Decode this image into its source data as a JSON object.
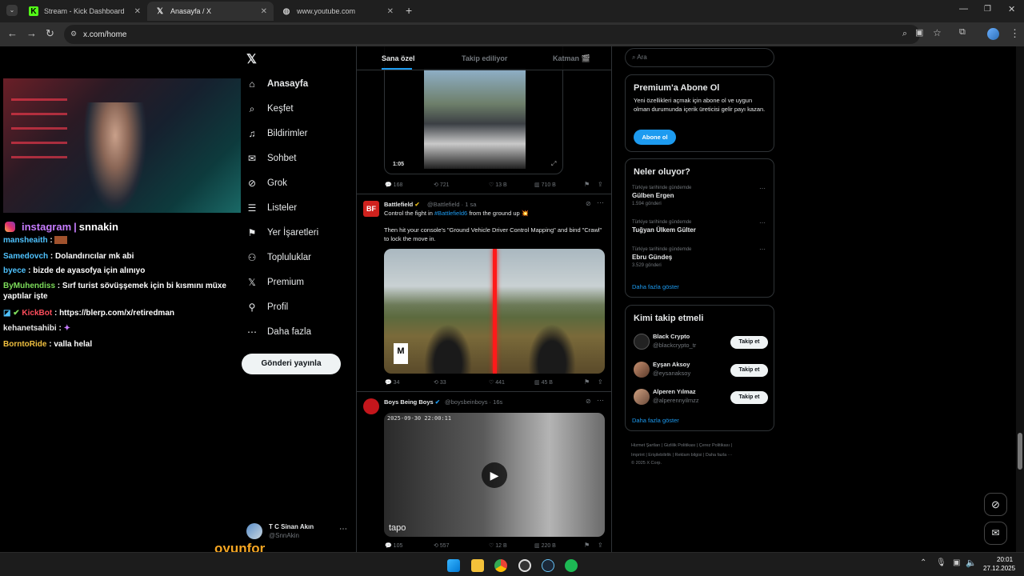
{
  "browser": {
    "tabs": [
      {
        "title": "Stream - Kick Dashboard",
        "icon": "kick-icon"
      },
      {
        "title": "Anasayfa / X",
        "icon": "x-logo-icon"
      },
      {
        "title": "www.youtube.com",
        "icon": "globe-icon"
      }
    ],
    "url": "x.com/home"
  },
  "stream": {
    "banner_left": "instagram",
    "banner_sep": "|",
    "banner_right": "snnakin",
    "chat": [
      {
        "user": "mansheaith",
        "msg": "",
        "color": "#4fc3ff"
      },
      {
        "user": "Samedovch",
        "msg": "Dolandırıcılar mk abi",
        "color": "#4fc3ff"
      },
      {
        "user": "byece",
        "msg": "bizde de ayasofya için alınıyo",
        "color": "#4fc3ff"
      },
      {
        "user": "ByMuhendiss",
        "msg": "Sırf turist sövüşşemek için bi kısmını müxe yaptılar işte",
        "color": "#7ddc5a"
      },
      {
        "user": "KickBot",
        "msg": "https://blerp.com/x/retiredman",
        "color": "#ff4d5c"
      },
      {
        "user": "kehanetsahibi",
        "msg": "",
        "color": "#e8e8e8"
      },
      {
        "user": "BorntoRide",
        "msg": "valla helal",
        "color": "#f0c040"
      }
    ],
    "watermark": "oyunfor"
  },
  "xnav": {
    "items": [
      {
        "label": "Anasayfa",
        "icon": "home-icon"
      },
      {
        "label": "Keşfet",
        "icon": "search-icon"
      },
      {
        "label": "Bildirimler",
        "icon": "bell-icon"
      },
      {
        "label": "Sohbet",
        "icon": "mail-icon"
      },
      {
        "label": "Grok",
        "icon": "grok-icon"
      },
      {
        "label": "Listeler",
        "icon": "list-icon"
      },
      {
        "label": "Yer İşaretleri",
        "icon": "bookmark-icon"
      },
      {
        "label": "Topluluklar",
        "icon": "people-icon"
      },
      {
        "label": "Premium",
        "icon": "x-logo-icon"
      },
      {
        "label": "Profil",
        "icon": "person-icon"
      },
      {
        "label": "Daha fazla",
        "icon": "more-icon"
      }
    ],
    "post_button": "Gönderi yayınla",
    "profile": {
      "name": "T C Sinan Akın",
      "handle": "@SnnAkin"
    }
  },
  "feed": {
    "tabs": [
      "Sana özel",
      "Takip ediliyor",
      "Katman 🎬"
    ],
    "post1": {
      "duration": "1:05",
      "replies": "168",
      "reposts": "721",
      "likes": "13 B",
      "views": "710 B"
    },
    "post2": {
      "name": "Battlefield",
      "handle": "@Battlefield · 1 sa",
      "text1": "Control the fight in ",
      "hashtag": "#Battlefield6",
      "text1b": " from the ground up 💥",
      "text2": "Then hit your console's \"Ground Vehicle Driver Control Mapping\" and bind \"Crawl\" to lock the move in.",
      "replies": "34",
      "reposts": "33",
      "likes": "441",
      "views": "45 B"
    },
    "post3": {
      "name": "Boys Being Boys",
      "handle": "@boysbeinboys · 16s",
      "timestamp": "2025-09-30 22:00:11",
      "logo": "tapo",
      "replies": "105",
      "reposts": "557",
      "likes": "12 B",
      "views": "220 B"
    }
  },
  "right": {
    "search_placeholder": "Ara",
    "premium": {
      "title": "Premium'a Abone Ol",
      "text": "Yeni özellikleri açmak için abone ol ve uygun olman durumunda içerik üreticisi gelir payı kazan.",
      "button": "Abone ol"
    },
    "trends_title": "Neler oluyor?",
    "trends": [
      {
        "context": "Türkiye tarihinde gündemde",
        "name": "Gülben Ergen",
        "count": "1.594 gönderi"
      },
      {
        "context": "Türkiye tarihinde gündemde",
        "name": "Tuğyan Ülkem Gülter",
        "count": ""
      },
      {
        "context": "Türkiye tarihinde gündemde",
        "name": "Ebru Gündeş",
        "count": "3.529 gönderi"
      }
    ],
    "show_more": "Daha fazla göster",
    "follow_title": "Kimi takip etmeli",
    "follow": [
      {
        "name": "Black Crypto",
        "handle": "@blackcrypto_tr"
      },
      {
        "name": "Eyşan Aksoy",
        "handle": "@eysanaksoy"
      },
      {
        "name": "Alperen Yılmaz",
        "handle": "@alperennyilmzz"
      }
    ],
    "follow_button": "Takip et",
    "footer_line1": "Hizmet Şartları | Gizlilik Politikası | Çerez Politikası |",
    "footer_line2": "Imprint | Erişilebilirlik | Reklam bilgisi | Daha fazla ···",
    "footer_line3": "© 2025 X Corp."
  },
  "taskbar": {
    "time": "20:01",
    "date": "27.12.2025"
  }
}
